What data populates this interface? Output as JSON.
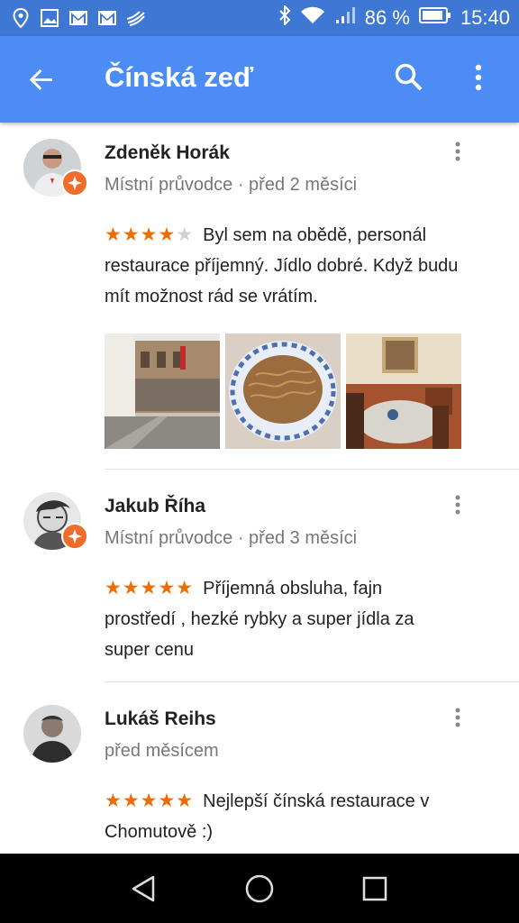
{
  "status_bar": {
    "battery_percent": "86 %",
    "time": "15:40",
    "left_icons": [
      "location-icon",
      "image-icon",
      "gmail-icon",
      "gmail-icon",
      "signal-app-icon"
    ],
    "right_icons": [
      "bluetooth-icon",
      "wifi-icon",
      "cellular-icon",
      "battery-icon"
    ]
  },
  "app_bar": {
    "title": "Čínská zeď",
    "icons": [
      "back-arrow-icon",
      "search-icon",
      "more-vert-icon"
    ]
  },
  "reviews": [
    {
      "author": "Zdeněk Horák",
      "meta": "Místní průvodce · před 2 měsíci",
      "rating": 4,
      "text_lines": [
        "Byl sem na obědě,  personál",
        "restaurace příjemný. Jídlo dobré. Když budu",
        "mít možnost rád se vrátím."
      ],
      "local_guide_badge": true,
      "photos": [
        "street-photo",
        "noodles-photo",
        "interior-photo"
      ]
    },
    {
      "author": "Jakub Říha",
      "meta": "Místní průvodce · před 3 měsíci",
      "rating": 5,
      "text_lines": [
        "Příjemná obsluha, fajn",
        "prostředí , hezké rybky a super jídla za",
        "super cenu"
      ],
      "local_guide_badge": true
    },
    {
      "author": "Lukáš Reihs",
      "meta": "před měsícem",
      "rating": 5,
      "text_lines": [
        "Nejlepší čínská restaurace v",
        "Chomutově :)"
      ],
      "local_guide_badge": false
    }
  ],
  "nav_bar": {
    "icons": [
      "nav-back-icon",
      "nav-home-icon",
      "nav-recents-icon"
    ]
  },
  "colors": {
    "status_bar": "#3f77d4",
    "app_bar": "#4b8cf5",
    "star": "#ef6c00",
    "badge": "#ef6c2a"
  }
}
